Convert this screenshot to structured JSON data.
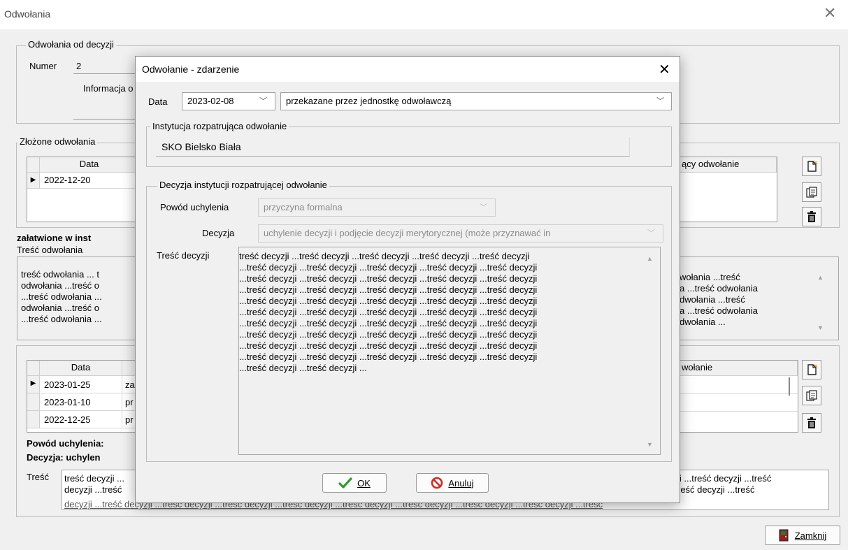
{
  "main_window": {
    "title": "Odwołania",
    "close_glyph": "✕",
    "group_decision": {
      "legend": "Odwołania od decyzji",
      "numer_label": "Numer",
      "numer_value": "2",
      "info_label": "Informacja o"
    },
    "group_appeals": {
      "legend": "Złożone odwołania",
      "col_date": "Data",
      "col_right": "ący odwołanie",
      "rows": [
        {
          "indicator": "▶",
          "date": "2022-12-20"
        }
      ]
    },
    "resolved_label": "załatwione w inst",
    "content_label": "Treść odwołania",
    "content_left": "treść odwołania ... t\nodwołania ...treść o\n...treść odwołania ...\nodwołania ...treść o\n...treść odwołania ...",
    "content_right": "wołania ...treść\na ...treść odwołania\ndwołania ...treść\na ...treść odwołania\ndwołania ...",
    "events": {
      "col_date": "Data",
      "col_right": "wołanie",
      "rows": [
        {
          "indicator": "▶",
          "date": "2023-01-25",
          "type": "za"
        },
        {
          "indicator": "",
          "date": "2023-01-10",
          "type": "pr"
        },
        {
          "indicator": "",
          "date": "2022-12-25",
          "type": "pr"
        }
      ]
    },
    "reason_label": "Powód uchylenia:",
    "decision_label": "Decyzja: uchylen",
    "tresc_label": "Treść",
    "tresc_left": "treść decyzji ...\ndecyzji ...treść",
    "tresc_right": "ji ...treść decyzji ...treść\nreść decyzji ...treść",
    "tresc_bottom": "decyzji ...treść decyzji ...treść decyzji ...treść decyzji ...treść decyzji ...treść decyzji ...treść decyzji ...treść decyzji ...treść decyzji ...treść",
    "close_button": "Zamknij"
  },
  "dialog": {
    "title": "Odwołanie - zdarzenie",
    "close_glyph": "✕",
    "date_label": "Data",
    "date_value": "2023-02-08",
    "type_value": "przekazane przez jednostkę odwoławczą",
    "institution": {
      "legend": "Instytucja rozpatrująca odwołanie",
      "value": "SKO Bielsko Biała"
    },
    "decision_group": {
      "legend": "Decyzja instytucji rozpatrującej odwołanie",
      "reason_label": "Powód uchylenia",
      "reason_value": "przyczyna formalna",
      "decision_label": "Decyzja",
      "decision_value": "uchylenie decyzji i podjęcie decyzji merytorycznej (może przyznawać in",
      "content_label": "Treść decyzji",
      "content_value": "treść decyzji ...treść decyzji ...treść decyzji ...treść decyzji ...treść decyzji\n...treść decyzji ...treść decyzji ...treść decyzji ...treść decyzji ...treść decyzji\n...treść decyzji ...treść decyzji ...treść decyzji ...treść decyzji ...treść decyzji\n...treść decyzji ...treść decyzji ...treść decyzji ...treść decyzji ...treść decyzji\n...treść decyzji ...treść decyzji ...treść decyzji ...treść decyzji ...treść decyzji\n...treść decyzji ...treść decyzji ...treść decyzji ...treść decyzji ...treść decyzji\n...treść decyzji ...treść decyzji ...treść decyzji ...treść decyzji ...treść decyzji\n...treść decyzji ...treść decyzji ...treść decyzji ...treść decyzji ...treść decyzji\n...treść decyzji ...treść decyzji ...treść decyzji ...treść decyzji ...treść decyzji\n...treść decyzji ...treść decyzji ...treść decyzji ...treść decyzji ...treść decyzji\n...treść decyzji ...treść decyzji ..."
    },
    "ok_button": "OK",
    "cancel_button": "Anuluj"
  },
  "colors": {
    "ok_check": "#2e9b2e",
    "cancel_icon": "#d42a1e",
    "exit_icon": "#9b1c1c"
  }
}
